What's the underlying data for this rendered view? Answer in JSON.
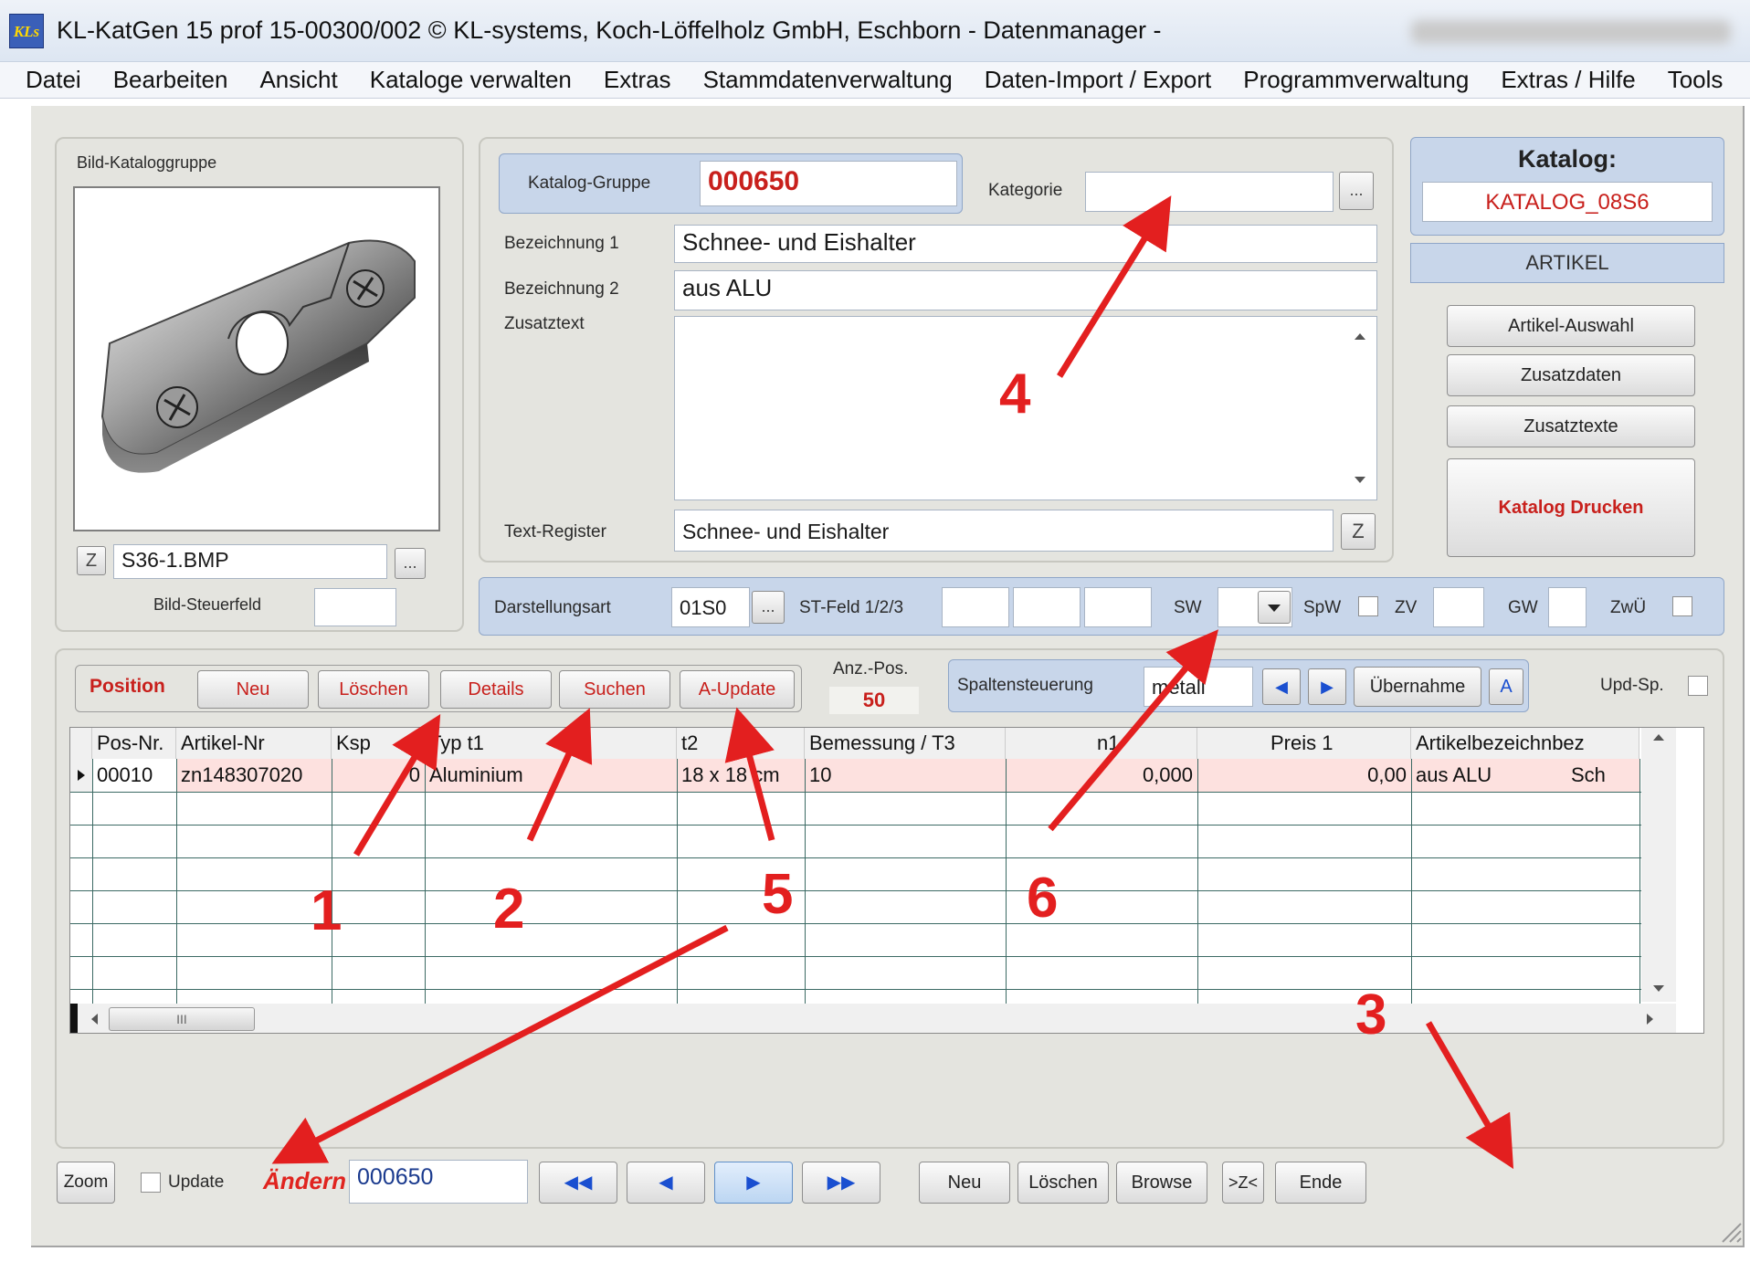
{
  "window": {
    "title": "KL-KatGen 15 prof  15-00300/002 © KL-systems, Koch-Löffelholz GmbH, Eschborn      - Datenmanager -",
    "logo_text": "KLs"
  },
  "menu": [
    "Datei",
    "Bearbeiten",
    "Ansicht",
    "Kataloge verwalten",
    "Extras",
    "Stammdatenverwaltung",
    "Daten-Import / Export",
    "Programmverwaltung",
    "Extras / Hilfe",
    "Tools"
  ],
  "image_group": {
    "title": "Bild-Kataloggruppe",
    "z_label": "Z",
    "filename": "S36-1.BMP",
    "browse_label": "...",
    "control_label": "Bild-Steuerfeld",
    "control_value": ""
  },
  "group": {
    "catalog_group_label": "Katalog-Gruppe",
    "catalog_group_value": "000650",
    "category_label": "Kategorie",
    "category_value": "",
    "category_btn": "...",
    "bez1_label": "Bezeichnung 1",
    "bez1_value": "Schnee- und Eishalter",
    "bez2_label": "Bezeichnung 2",
    "bez2_value": "aus ALU",
    "zusatz_label": "Zusatztext",
    "zusatz_value": "",
    "register_label": "Text-Register",
    "register_value": "Schnee- und Eishalter",
    "register_btn": "Z"
  },
  "catalog": {
    "title": "Katalog:",
    "name": "KATALOG_08S6",
    "mode": "ARTIKEL",
    "buttons": [
      "Artikel-Auswahl",
      "Zusatzdaten",
      "Zusatztexte"
    ],
    "print_label": "Katalog  Drucken"
  },
  "display": {
    "art_label": "Darstellungsart",
    "art_value": "01S0",
    "art_btn": "...",
    "st_label": "ST-Feld 1/2/3",
    "st_values": [
      "",
      "",
      ""
    ],
    "sw_label": "SW",
    "spw_label": "SpW",
    "zv_label": "ZV",
    "gw_label": "GW",
    "zwu_label": "ZwÜ"
  },
  "position": {
    "label": "Position",
    "buttons": [
      "Neu",
      "Löschen",
      "Details",
      "Suchen",
      "A-Update"
    ],
    "count_label": "Anz.-Pos.",
    "count_value": "50",
    "column_label": "Spaltensteuerung",
    "column_value": "metall",
    "prev_arrow": "◀",
    "next_arrow": "▶",
    "apply_label": "Übernahme",
    "a_label": "A",
    "upd_label": "Upd-Sp."
  },
  "grid": {
    "columns": [
      "Pos-Nr.",
      "Artikel-Nr",
      "Ksp",
      "Typ  t1",
      "t2",
      "Bemessung  / T3",
      "n1",
      "Preis 1",
      "Artikelbezeichnbez"
    ],
    "rows": [
      [
        "00010",
        "zn148307020",
        "0",
        "Aluminium",
        "18 x 18 cm",
        "10",
        "0,000",
        "0,00",
        "aus ALU",
        "Sch"
      ]
    ],
    "hscroll_grip": "III"
  },
  "footer": {
    "zoom_label": "Zoom",
    "update_label": "Update",
    "mode_label": "Ändern",
    "record_value": "000650",
    "nav": [
      "◀◀",
      "◀",
      "▶",
      "▶▶"
    ],
    "buttons": [
      "Neu",
      "Löschen",
      "Browse",
      ">Z<",
      "Ende"
    ]
  },
  "annotations": [
    "1",
    "2",
    "3",
    "4",
    "5",
    "6"
  ],
  "colors": {
    "accent_red": "#c8201c",
    "annotation_red": "#e31f1f",
    "panel_blue": "#c8d6ea",
    "row_highlight": "#fde1df"
  }
}
